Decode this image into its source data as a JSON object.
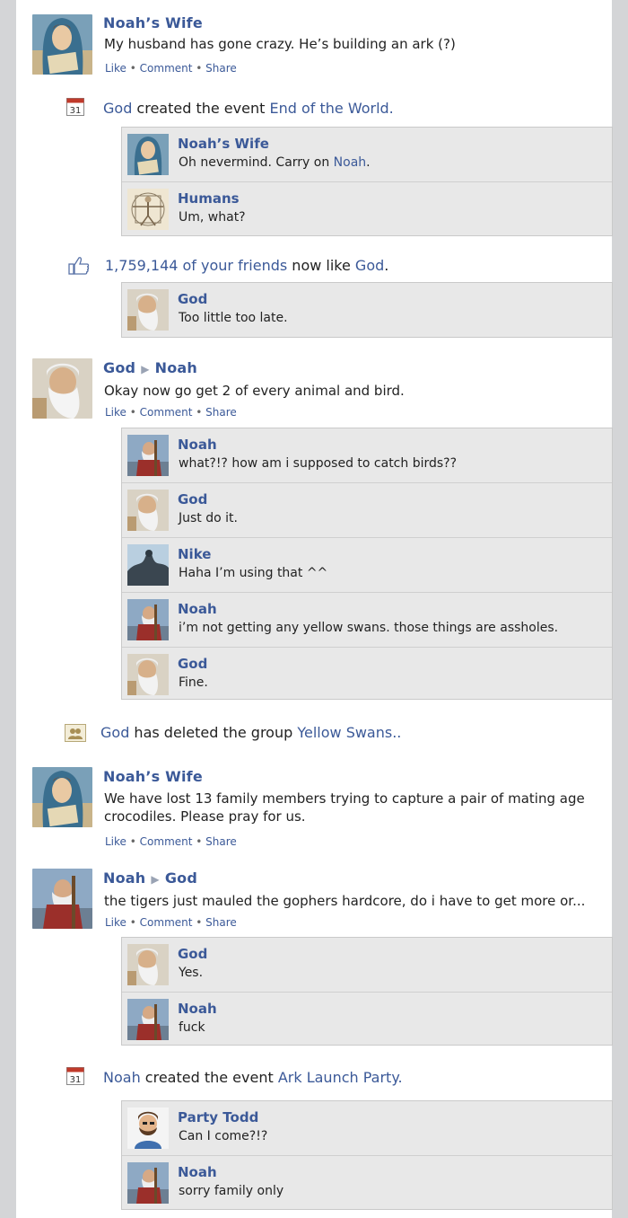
{
  "posts": {
    "p1": {
      "author": "Noah’s Wife",
      "text": "My husband has gone crazy. He’s building an ark (?)"
    },
    "p2": {
      "author": "God",
      "target": "Noah",
      "text": "Okay now go get 2 of every animal and bird."
    },
    "p3": {
      "author": "Noah’s Wife",
      "text_line1": "We have lost 13 family members trying to capture a pair of mating age",
      "text_line2": "crocodiles. Please pray for us."
    },
    "p4": {
      "author": "Noah",
      "target": "God",
      "text": "the tigers just mauled the gophers hardcore, do i have to get more or..."
    }
  },
  "actions": {
    "like": "Like",
    "comment": "Comment",
    "share": "Share",
    "sep": " • "
  },
  "events": {
    "e1": {
      "actor": "God",
      "verb": " created the event ",
      "event_name": "End of the World.",
      "icon_day": "31"
    },
    "e2": {
      "count": "1,759,144 of your friends",
      "verb": " now like ",
      "page": "God",
      "end": "."
    },
    "e3": {
      "actor": "God",
      "verb": " has deleted the group ",
      "group": "Yellow Swans.."
    },
    "e4": {
      "actor": "Noah",
      "verb": " created the event ",
      "event_name": "Ark Launch Party.",
      "icon_day": "31"
    }
  },
  "comments": {
    "c1": [
      {
        "name": "Noah’s Wife",
        "text_pre": "Oh nevermind. Carry on ",
        "text_link": "Noah",
        "text_post": "."
      },
      {
        "name": "Humans",
        "text": "Um, what?"
      }
    ],
    "c2": [
      {
        "name": "God",
        "text": "Too little too late."
      }
    ],
    "c3": [
      {
        "name": "Noah",
        "text": "what?!? how am i supposed to catch birds??"
      },
      {
        "name": "God",
        "text": "Just do it."
      },
      {
        "name": "Nike",
        "text": "Haha I’m using that ^^"
      },
      {
        "name": "Noah",
        "text": "i’m not getting any yellow swans. those things are assholes."
      },
      {
        "name": "God",
        "text": "Fine."
      }
    ],
    "c4": [
      {
        "name": "God",
        "text": "Yes."
      },
      {
        "name": "Noah",
        "text": "fuck"
      }
    ],
    "c5": [
      {
        "name": "Party Todd",
        "text": "Can I come?!?"
      },
      {
        "name": "Noah",
        "text": "sorry family only"
      }
    ]
  },
  "colors": {
    "link": "#3b5998",
    "comment_bg": "#e8e8e8",
    "page_bg": "#d4d5d7"
  }
}
